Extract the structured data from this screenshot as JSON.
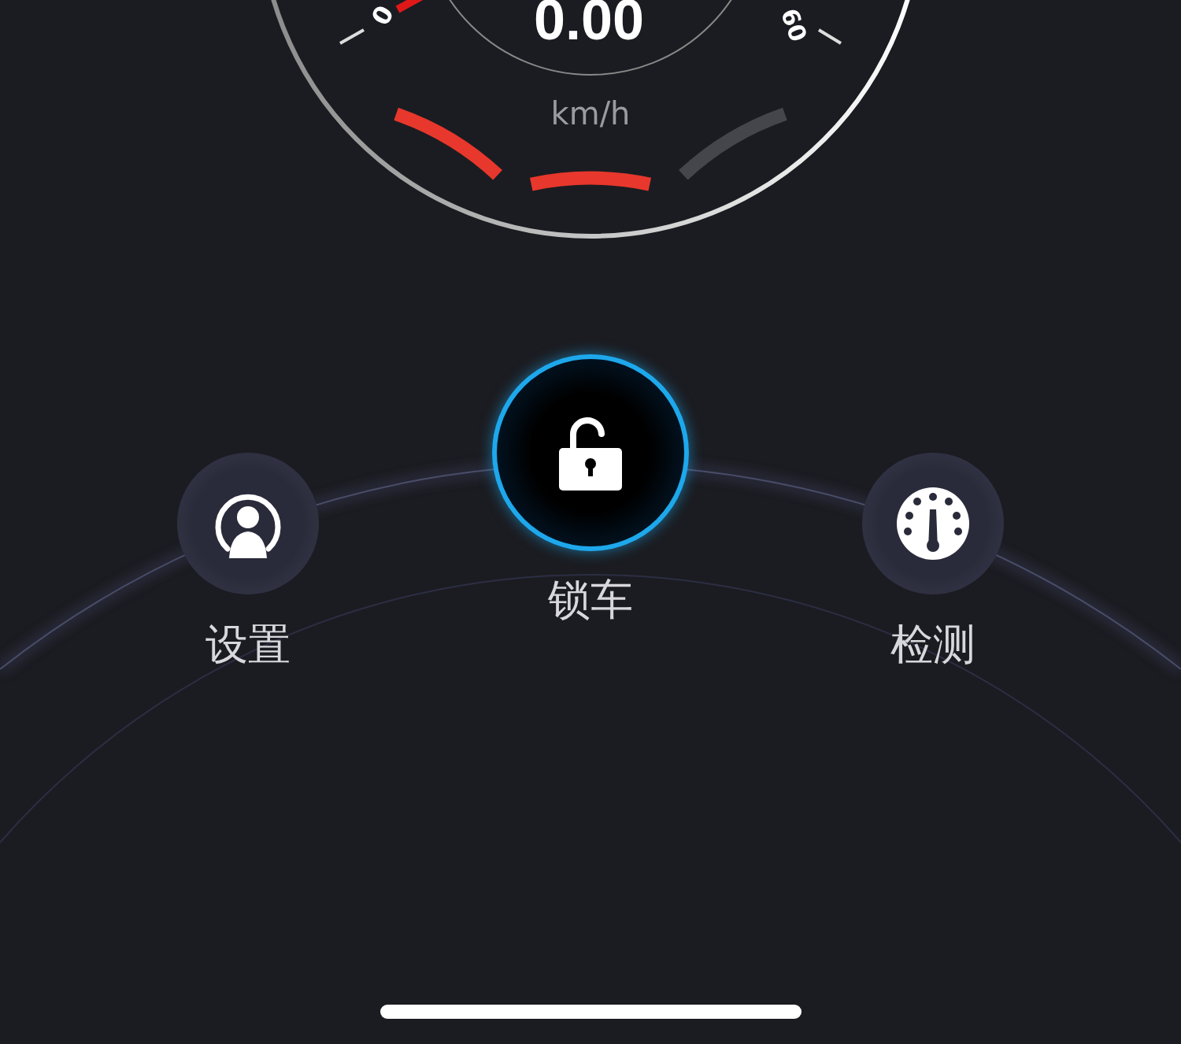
{
  "speedometer": {
    "speed": "0.00",
    "unit": "km/h",
    "scale_labels": [
      "0",
      "60"
    ]
  },
  "actions": [
    {
      "label": "设置",
      "kind": "settings",
      "selected": false
    },
    {
      "label": "锁车",
      "kind": "lock",
      "selected": true
    },
    {
      "label": "检测",
      "kind": "diagnostics",
      "selected": false
    }
  ]
}
